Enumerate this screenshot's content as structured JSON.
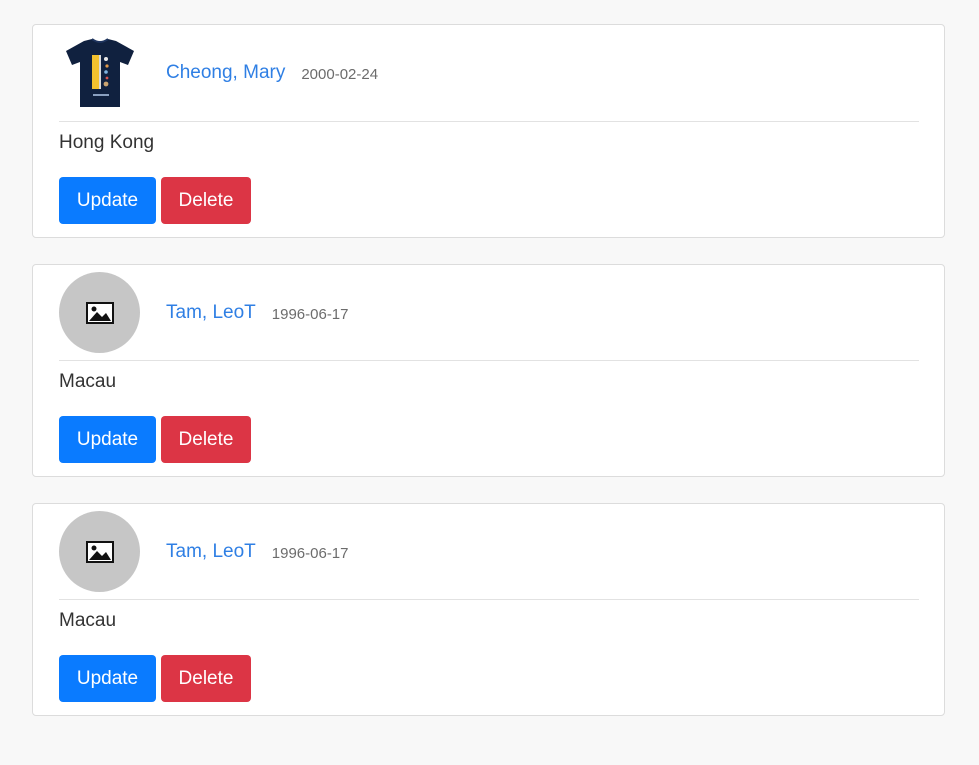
{
  "people": [
    {
      "name": "Cheong, Mary",
      "dob": "2000-02-24",
      "city": "Hong Kong",
      "avatar": "tshirt-photo",
      "update_label": "Update",
      "delete_label": "Delete"
    },
    {
      "name": "Tam, LeoT",
      "dob": "1996-06-17",
      "city": "Macau",
      "avatar": "image-placeholder-icon",
      "update_label": "Update",
      "delete_label": "Delete"
    },
    {
      "name": "Tam, LeoT",
      "dob": "1996-06-17",
      "city": "Macau",
      "avatar": "image-placeholder-icon",
      "update_label": "Update",
      "delete_label": "Delete"
    }
  ],
  "colors": {
    "link": "#2f7fe4",
    "update": "#0a7bff",
    "delete": "#dc3545",
    "placeholder": "#c6c6c6"
  }
}
